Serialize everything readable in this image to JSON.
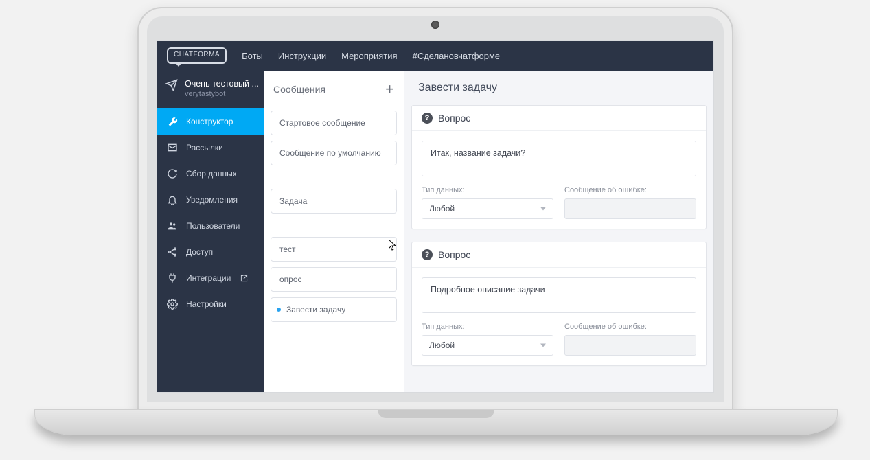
{
  "brand": "CHATFORMA",
  "nav": {
    "bots": "Боты",
    "instructions": "Инструкции",
    "events": "Мероприятия",
    "hashtag": "#Сделановчатформе"
  },
  "bot": {
    "title": "Очень тестовый ...",
    "handle": "verytastybot"
  },
  "sidebar": {
    "items": [
      {
        "label": "Конструктор"
      },
      {
        "label": "Рассылки"
      },
      {
        "label": "Сбор данных"
      },
      {
        "label": "Уведомления"
      },
      {
        "label": "Пользователи"
      },
      {
        "label": "Доступ"
      },
      {
        "label": "Интеграции"
      },
      {
        "label": "Настройки"
      }
    ]
  },
  "messages": {
    "title": "Сообщения",
    "items": [
      {
        "label": "Стартовое сообщение"
      },
      {
        "label": "Сообщение по умолчанию"
      },
      {
        "label": "Задача"
      },
      {
        "label": "тест"
      },
      {
        "label": "опрос"
      },
      {
        "label": "Завести задачу"
      }
    ]
  },
  "editor": {
    "title": "Завести задачу",
    "question_label": "Вопрос",
    "data_type_label": "Тип данных:",
    "error_label": "Сообщение об ошибке:",
    "q1_text": "Итак, название задачи?",
    "q1_type": "Любой",
    "q2_text": "Подробное описание задачи",
    "q2_type": "Любой"
  },
  "colors": {
    "accent": "#00a9f4",
    "header": "#2b3446"
  }
}
